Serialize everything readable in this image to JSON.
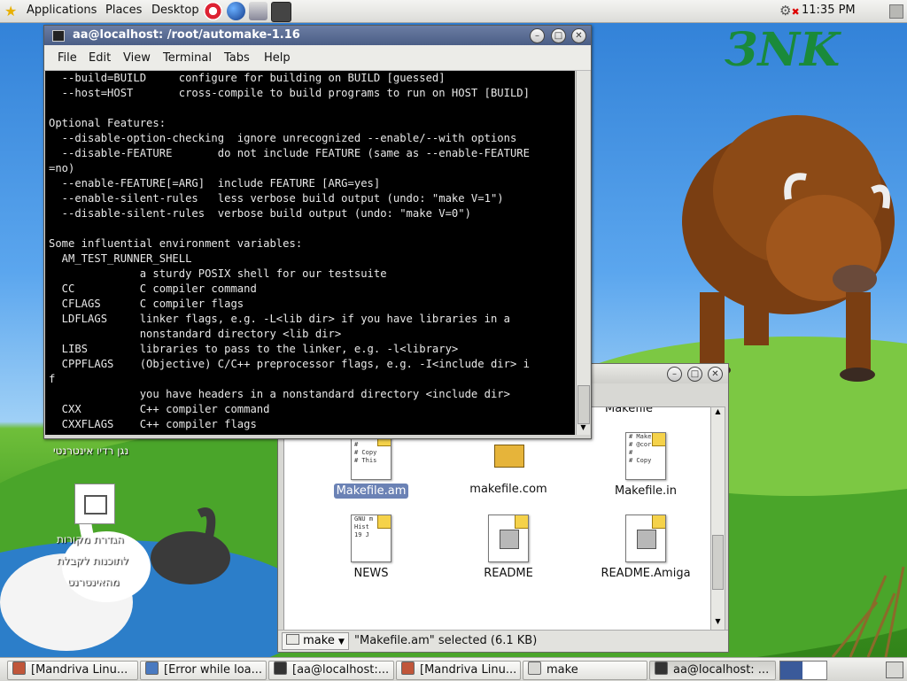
{
  "top_panel": {
    "menus": [
      "Applications",
      "Places",
      "Desktop"
    ],
    "clock": "11:35 PM",
    "launchers": [
      "help-lifebuoy-icon",
      "web-browser-globe-icon",
      "email-icon",
      "terminal-icon"
    ]
  },
  "desktop": {
    "logo_text": "ЗNK",
    "icons": [
      {
        "label": "נגן רדיו אינטרנטי"
      },
      {
        "label_lines": [
          "הגדרת מקורות",
          "לתוכנות לקבלת",
          "מהאינטרנט"
        ]
      }
    ]
  },
  "terminal": {
    "title": "aa@localhost: /root/automake-1.16",
    "menu": [
      "File",
      "Edit",
      "View",
      "Terminal",
      "Tabs",
      "Help"
    ],
    "lines": [
      "  --build=BUILD     configure for building on BUILD [guessed]",
      "  --host=HOST       cross-compile to build programs to run on HOST [BUILD]",
      "",
      "Optional Features:",
      "  --disable-option-checking  ignore unrecognized --enable/--with options",
      "  --disable-FEATURE       do not include FEATURE (same as --enable-FEATURE",
      "=no)",
      "  --enable-FEATURE[=ARG]  include FEATURE [ARG=yes]",
      "  --enable-silent-rules   less verbose build output (undo: \"make V=1\")",
      "  --disable-silent-rules  verbose build output (undo: \"make V=0\")",
      "",
      "Some influential environment variables:",
      "  AM_TEST_RUNNER_SHELL",
      "              a sturdy POSIX shell for our testsuite",
      "  CC          C compiler command",
      "  CFLAGS      C compiler flags",
      "  LDFLAGS     linker flags, e.g. -L<lib dir> if you have libraries in a",
      "              nonstandard directory <lib dir>",
      "  LIBS        libraries to pass to the linker, e.g. -l<library>",
      "  CPPFLAGS    (Objective) C/C++ preprocessor flags, e.g. -I<include dir> i",
      "f",
      "              you have headers in a nonstandard directory <include dir>",
      "  CXX         C++ compiler command",
      "  CXXFLAGS    C++ compiler flags"
    ]
  },
  "file_manager": {
    "partial_top_label": "Makefile",
    "files": [
      {
        "name": "Makefile.am",
        "preview": [
          "# This",
          "#",
          "# Copy",
          "# This"
        ],
        "selected": true,
        "kind": "text"
      },
      {
        "name": "makefile.com",
        "preview": [],
        "selected": false,
        "kind": "build"
      },
      {
        "name": "Makefile.in",
        "preview": [
          "# Make",
          "# @cor",
          "#",
          "# Copy"
        ],
        "selected": false,
        "kind": "text"
      },
      {
        "name": "NEWS",
        "preview": [
          "GNU m",
          "  Hist",
          "  19 J"
        ],
        "selected": false,
        "kind": "text"
      },
      {
        "name": "README",
        "preview": [],
        "selected": false,
        "kind": "exec"
      },
      {
        "name": "README.Amiga",
        "preview": [],
        "selected": false,
        "kind": "exec"
      }
    ],
    "path_button": "make",
    "status": "\"Makefile.am\" selected (6.1 KB)"
  },
  "taskbar": {
    "tasks": [
      {
        "label": "[Mandriva Linu...",
        "icon": "browser-icon"
      },
      {
        "label": "[Error while loa...",
        "icon": "dialog-icon"
      },
      {
        "label": "[aa@localhost:...",
        "icon": "terminal-icon"
      },
      {
        "label": "[Mandriva Linu...",
        "icon": "browser-icon"
      },
      {
        "label": "make",
        "icon": "folder-icon"
      },
      {
        "label": "aa@localhost: ...",
        "icon": "terminal-icon"
      }
    ]
  },
  "colors": {
    "titlebar_active": "#4b5e86",
    "selection": "#6b82b5",
    "terminal_bg": "#000000"
  }
}
